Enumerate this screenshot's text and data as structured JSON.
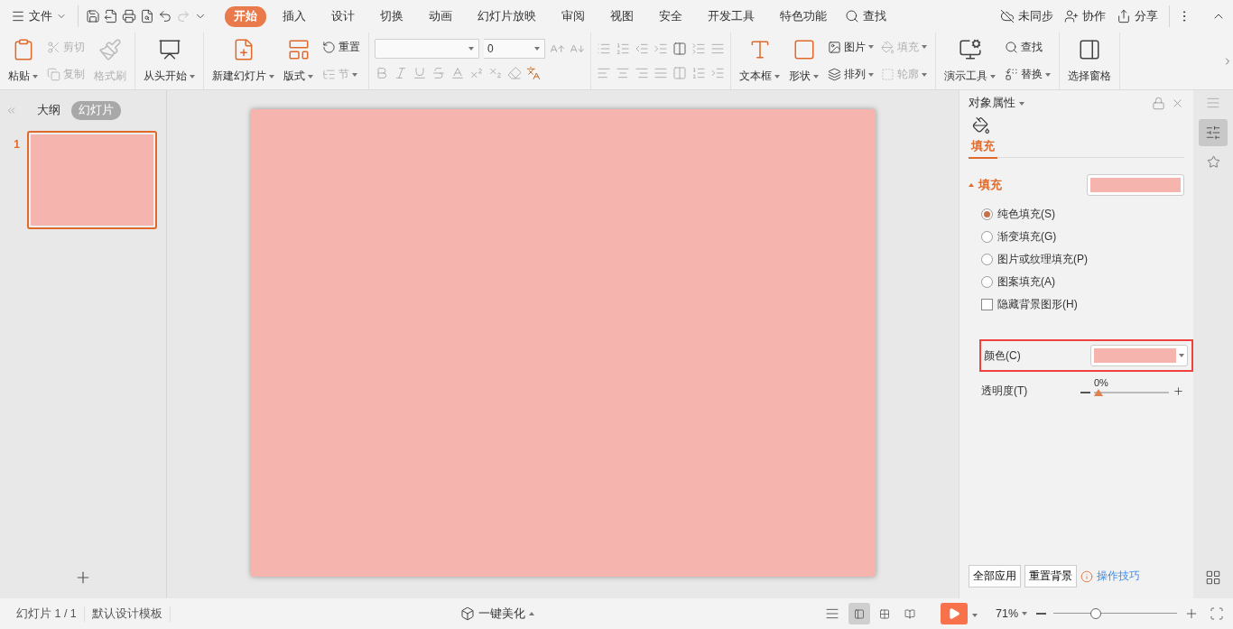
{
  "menu": {
    "file": "文件"
  },
  "tabs": [
    {
      "label": "开始",
      "selected": true
    },
    {
      "label": "插入",
      "selected": false
    },
    {
      "label": "设计",
      "selected": false
    },
    {
      "label": "切换",
      "selected": false
    },
    {
      "label": "动画",
      "selected": false
    },
    {
      "label": "幻灯片放映",
      "selected": false
    },
    {
      "label": "审阅",
      "selected": false
    },
    {
      "label": "视图",
      "selected": false
    },
    {
      "label": "安全",
      "selected": false
    },
    {
      "label": "开发工具",
      "selected": false
    },
    {
      "label": "特色功能",
      "selected": false
    }
  ],
  "search": {
    "label": "查找"
  },
  "top_actions": [
    {
      "label": "未同步"
    },
    {
      "label": "协作"
    },
    {
      "label": "分享"
    }
  ],
  "ribbon": [
    {
      "items": [
        {
          "kind": "large",
          "label": "粘贴",
          "disabled": false,
          "dropdown": true
        },
        {
          "kind": "small",
          "label": "剪切",
          "disabled": true,
          "dropdown": false
        },
        {
          "kind": "small",
          "label": "复制",
          "disabled": true,
          "dropdown": false
        },
        {
          "kind": "large",
          "label": "格式刷",
          "disabled": true,
          "dropdown": false
        }
      ]
    },
    {
      "items": [
        {
          "kind": "large",
          "label": "从头开始",
          "disabled": false,
          "dropdown": true
        }
      ]
    },
    {
      "items": [
        {
          "kind": "large",
          "label": "新建幻灯片",
          "disabled": false,
          "dropdown": true
        },
        {
          "kind": "large",
          "label": "版式",
          "disabled": false,
          "dropdown": true
        },
        {
          "kind": "small",
          "label": "重置",
          "disabled": false,
          "dropdown": false
        },
        {
          "kind": "small",
          "label": "节",
          "disabled": true,
          "dropdown": true
        }
      ]
    },
    {
      "items": [
        {
          "kind": "font"
        }
      ]
    },
    {
      "items": [
        {
          "kind": "paragraph"
        }
      ]
    },
    {
      "items": [
        {
          "kind": "large",
          "label": "文本框",
          "disabled": false,
          "dropdown": true
        },
        {
          "kind": "large",
          "label": "形状",
          "disabled": false,
          "dropdown": true
        },
        {
          "kind": "small",
          "label": "图片",
          "disabled": false,
          "dropdown": true
        },
        {
          "kind": "small",
          "label": "排列",
          "disabled": false,
          "dropdown": true
        },
        {
          "kind": "small",
          "label": "填充",
          "disabled": true,
          "dropdown": true
        },
        {
          "kind": "small",
          "label": "轮廓",
          "disabled": true,
          "dropdown": true
        }
      ]
    },
    {
      "items": [
        {
          "kind": "large",
          "label": "演示工具",
          "disabled": false,
          "dropdown": true
        },
        {
          "kind": "small",
          "label": "查找",
          "disabled": false,
          "dropdown": false
        },
        {
          "kind": "small",
          "label": "替换",
          "disabled": false,
          "dropdown": true
        }
      ]
    },
    {
      "items": [
        {
          "kind": "large",
          "label": "选择窗格",
          "disabled": false,
          "dropdown": false
        }
      ]
    }
  ],
  "font": {
    "size": "0"
  },
  "outline_tabs": [
    {
      "label": "大纲",
      "selected": false
    },
    {
      "label": "幻灯片",
      "selected": true
    }
  ],
  "slides": [
    {
      "number": "1",
      "selected": true,
      "color": "#f5b5ae"
    }
  ],
  "properties": {
    "title": "对象属性",
    "tab": "填充",
    "section": {
      "label": "填充",
      "expanded": true
    },
    "fill_swatch": {
      "color": "#f5b5ae"
    },
    "options": [
      {
        "kind": "radio",
        "label": "纯色填充(S)",
        "selected": true
      },
      {
        "kind": "radio",
        "label": "渐变填充(G)",
        "selected": false
      },
      {
        "kind": "radio",
        "label": "图片或纹理填充(P)",
        "selected": false
      },
      {
        "kind": "radio",
        "label": "图案填充(A)",
        "selected": false
      },
      {
        "kind": "checkbox",
        "label": "隐藏背景图形(H)",
        "checked": false
      }
    ],
    "color_field": {
      "label": "颜色(C)",
      "color": "#f5b5ae"
    },
    "transparency": {
      "label": "透明度(T)",
      "reading": "0%",
      "level": 0
    },
    "buttons": [
      "全部应用",
      "重置背景"
    ],
    "help_link": "操作技巧"
  },
  "status": {
    "slide": "幻灯片 1 / 1",
    "template": "默认设计模板",
    "beautify": "一键美化",
    "views": [
      {
        "selected": true
      },
      {
        "selected": false
      },
      {
        "selected": false
      }
    ],
    "zoom": "71%",
    "zoom_slider": {
      "level": 0.34
    }
  }
}
